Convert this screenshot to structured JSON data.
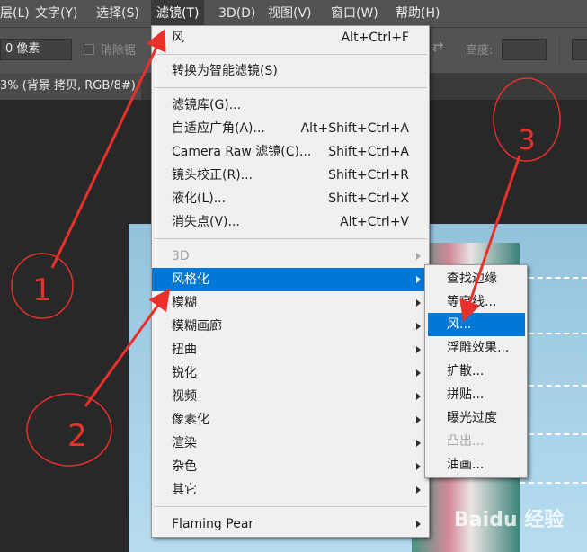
{
  "menubar": {
    "items": [
      {
        "label": "层(L)"
      },
      {
        "label": "文字(Y)"
      },
      {
        "label": "选择(S)"
      },
      {
        "label": "滤镜(T)"
      },
      {
        "label": "3D(D)"
      },
      {
        "label": "视图(V)"
      },
      {
        "label": "窗口(W)"
      },
      {
        "label": "帮助(H)"
      }
    ]
  },
  "options": {
    "feather_value": "0 像素",
    "antialias_label": "消除锯",
    "height_label": "高度:"
  },
  "document": {
    "tab_title": "3% (背景 拷贝, RGB/8#)"
  },
  "filter_menu": {
    "items": [
      {
        "label": "风",
        "shortcut": "Alt+Ctrl+F"
      },
      {
        "label": "转换为智能滤镜(S)",
        "shortcut": ""
      },
      {
        "label": "滤镜库(G)...",
        "shortcut": ""
      },
      {
        "label": "自适应广角(A)...",
        "shortcut": "Alt+Shift+Ctrl+A"
      },
      {
        "label": "Camera Raw 滤镜(C)...",
        "shortcut": "Shift+Ctrl+A"
      },
      {
        "label": "镜头校正(R)...",
        "shortcut": "Shift+Ctrl+R"
      },
      {
        "label": "液化(L)...",
        "shortcut": "Shift+Ctrl+X"
      },
      {
        "label": "消失点(V)...",
        "shortcut": "Alt+Ctrl+V"
      },
      {
        "label": "3D"
      },
      {
        "label": "风格化"
      },
      {
        "label": "模糊"
      },
      {
        "label": "模糊画廊"
      },
      {
        "label": "扭曲"
      },
      {
        "label": "锐化"
      },
      {
        "label": "视频"
      },
      {
        "label": "像素化"
      },
      {
        "label": "渲染"
      },
      {
        "label": "杂色"
      },
      {
        "label": "其它"
      },
      {
        "label": "Flaming Pear"
      }
    ]
  },
  "stylize_submenu": {
    "items": [
      {
        "label": "查找边缘"
      },
      {
        "label": "等高线..."
      },
      {
        "label": "风..."
      },
      {
        "label": "浮雕效果..."
      },
      {
        "label": "扩散..."
      },
      {
        "label": "拼贴..."
      },
      {
        "label": "曝光过度"
      },
      {
        "label": "凸出..."
      },
      {
        "label": "油画..."
      }
    ]
  },
  "annotations": {
    "step1": "1",
    "step2": "2",
    "step3": "3",
    "color": "#e8312a"
  },
  "watermark": {
    "text": "Baidu 经验"
  }
}
